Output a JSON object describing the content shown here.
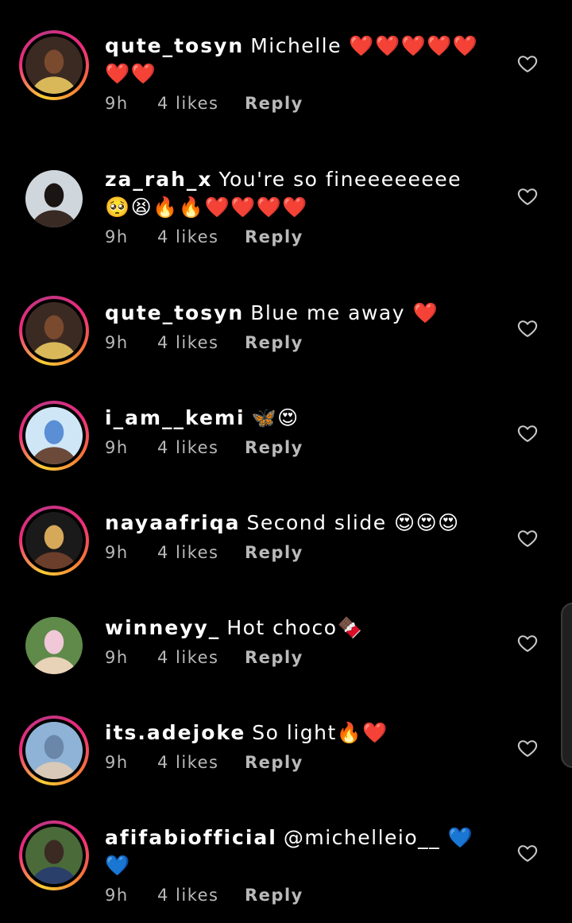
{
  "comments": [
    {
      "username": "qute_tosyn",
      "text": "Michelle ❤️❤️❤️❤️❤️❤️❤️",
      "time": "9h",
      "likes": "4 likes",
      "reply": "Reply",
      "avatar_ring": true,
      "avatar_colors": [
        "#3b2a22",
        "#d9b85a",
        "#7a4a2e"
      ]
    },
    {
      "username": "za_rah_x",
      "text": "You're so fineeeeeeee 🥺😫🔥🔥❤️❤️❤️❤️",
      "time": "9h",
      "likes": "4 likes",
      "reply": "Reply",
      "avatar_ring": false,
      "avatar_colors": [
        "#cfd6dc",
        "#3a2a24",
        "#1a1412"
      ]
    },
    {
      "username": "qute_tosyn",
      "text": "Blue me away ❤️",
      "time": "9h",
      "likes": "4 likes",
      "reply": "Reply",
      "avatar_ring": true,
      "avatar_colors": [
        "#3b2a22",
        "#d9b85a",
        "#7a4a2e"
      ]
    },
    {
      "username": "i_am__kemi",
      "text": "🦋😍",
      "time": "9h",
      "likes": "4 likes",
      "reply": "Reply",
      "avatar_ring": true,
      "avatar_colors": [
        "#cfe6f7",
        "#6b4a3a",
        "#5a8fd6"
      ]
    },
    {
      "username": "nayaafriqa",
      "text": "Second slide 😍😍😍",
      "time": "9h",
      "likes": "4 likes",
      "reply": "Reply",
      "avatar_ring": true,
      "avatar_colors": [
        "#1a1a1a",
        "#6a3e2a",
        "#d6a85a"
      ]
    },
    {
      "username": "winneyy_",
      "text": "Hot choco🍫",
      "time": "9h",
      "likes": "4 likes",
      "reply": "Reply",
      "avatar_ring": false,
      "avatar_colors": [
        "#5f8a4a",
        "#e8d2b8",
        "#f0c8d8"
      ]
    },
    {
      "username": "its.adejoke",
      "text": "So light🔥❤️",
      "time": "9h",
      "likes": "4 likes",
      "reply": "Reply",
      "avatar_ring": true,
      "avatar_colors": [
        "#8fb3d6",
        "#d8c9b8",
        "#6a86a8"
      ]
    },
    {
      "username": "afifabiofficial",
      "text": "@michelleio__ 💙💙",
      "time": "9h",
      "likes": "4 likes",
      "reply": "Reply",
      "avatar_ring": true,
      "avatar_colors": [
        "#4a6a3a",
        "#2a3f6a",
        "#3a2a22"
      ]
    }
  ],
  "colors": {
    "background": "#000000",
    "text": "#ffffff",
    "meta_text": "#b9b9b9"
  },
  "icons": {
    "like": "heart-outline-icon"
  }
}
